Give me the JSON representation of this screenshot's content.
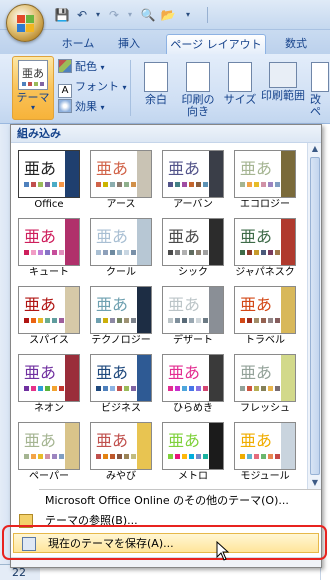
{
  "tabs": [
    {
      "label": "ホーム",
      "active": false
    },
    {
      "label": "挿入",
      "active": false
    },
    {
      "label": "ページ レイアウト",
      "active": true
    },
    {
      "label": "数式",
      "active": false
    }
  ],
  "ribbon": {
    "theme_button": "テーマ",
    "colors": "配色",
    "fonts": "フォント",
    "effects": "効果",
    "margins": "余白",
    "orientation_line1": "印刷の",
    "orientation_line2": "向き",
    "size": "サイズ",
    "print_area": "印刷範囲",
    "breaks_partial": "改ペ"
  },
  "gallery": {
    "header": "組み込み",
    "sample_text": "亜あ",
    "themes": [
      {
        "name": "Office",
        "fold": "#1f3f6f",
        "swatches": [
          "#4f81bd",
          "#c0504d",
          "#9bbb59",
          "#8064a2",
          "#4bacc6",
          "#f79646"
        ]
      },
      {
        "name": "アース",
        "fold": "#c9c3b4",
        "swatches": [
          "#d16349",
          "#ccb400",
          "#8cadae",
          "#8c7b70",
          "#8fb08c",
          "#d19049"
        ]
      },
      {
        "name": "アーバン",
        "fold": "#3a3e48",
        "swatches": [
          "#53548a",
          "#438086",
          "#a04da3",
          "#c4652d",
          "#8b5d3d",
          "#5c92b5"
        ]
      },
      {
        "name": "エコロジー",
        "fold": "#7a6a3a",
        "swatches": [
          "#a5b592",
          "#f3a447",
          "#e7bc29",
          "#d092a7",
          "#9c85c0",
          "#809ec2"
        ]
      },
      {
        "name": "キュート",
        "fold": "#b0306b",
        "swatches": [
          "#ce1e5c",
          "#f19dc5",
          "#c07fd8",
          "#8674c6",
          "#c64d9a",
          "#e18fbd"
        ]
      },
      {
        "name": "クール",
        "fold": "#b7c7d4",
        "swatches": [
          "#a9bfd3",
          "#8ea0ba",
          "#6e8aa0",
          "#9bb6c9",
          "#c8d6e2",
          "#7990a8"
        ]
      },
      {
        "name": "シック",
        "fold": "#2c2c2c",
        "swatches": [
          "#4b4b4b",
          "#7f7f7f",
          "#b0b0b0",
          "#5f6b5f",
          "#8c8071",
          "#a0a0a0"
        ]
      },
      {
        "name": "ジャパネスク",
        "fold": "#b03a2e",
        "swatches": [
          "#3e6b48",
          "#8f3a2c",
          "#c79a2c",
          "#4a5a7a",
          "#7a3b5c",
          "#a07a4a"
        ]
      },
      {
        "name": "スパイス",
        "fold": "#d6c9a8",
        "swatches": [
          "#b01513",
          "#ea6312",
          "#e6b729",
          "#6aac90",
          "#5f9c9d",
          "#9e5e9b"
        ]
      },
      {
        "name": "テクノロジー",
        "fold": "#1d2d44",
        "swatches": [
          "#6ea0b0",
          "#ccaf0a",
          "#8d89a4",
          "#748560",
          "#9e9273",
          "#7e848d"
        ]
      },
      {
        "name": "デザート",
        "fold": "#8a8f96",
        "swatches": [
          "#bcc5c8",
          "#7f8f9b",
          "#5a6b78",
          "#9aa8b2",
          "#cfd6da",
          "#6c7a84"
        ]
      },
      {
        "name": "トラベル",
        "fold": "#d8b85a",
        "swatches": [
          "#d34817",
          "#9b2d1f",
          "#a28e6a",
          "#956251",
          "#918485",
          "#855d5d"
        ]
      },
      {
        "name": "ネオン",
        "fold": "#9a2d3a",
        "swatches": [
          "#7030a0",
          "#e5328a",
          "#2e9cd8",
          "#5bb43c",
          "#f3a32f",
          "#c3352f"
        ]
      },
      {
        "name": "ビジネス",
        "fold": "#2e5a94",
        "swatches": [
          "#1f497d",
          "#4f81bd",
          "#8db3e2",
          "#c0504d",
          "#9bbb59",
          "#8064a2"
        ]
      },
      {
        "name": "ひらめき",
        "fold": "#3a3a3a",
        "swatches": [
          "#e32d91",
          "#c830cc",
          "#4ea6dc",
          "#4775e7",
          "#8971e1",
          "#d54773"
        ]
      },
      {
        "name": "フレッシュ",
        "fold": "#d2d98a",
        "swatches": [
          "#93a299",
          "#cf543f",
          "#b5ae53",
          "#848058",
          "#e8b54d",
          "#786c71"
        ]
      },
      {
        "name": "ペーパー",
        "fold": "#d9c48a",
        "swatches": [
          "#a5b592",
          "#f3a447",
          "#e7bc29",
          "#d092a7",
          "#9c85c0",
          "#809ec2"
        ]
      },
      {
        "name": "みやび",
        "fold": "#e8c451",
        "swatches": [
          "#c0504d",
          "#e48312",
          "#bd582c",
          "#865640",
          "#9b8357",
          "#c2bc80"
        ]
      },
      {
        "name": "メトロ",
        "fold": "#1b1b1b",
        "swatches": [
          "#7fd13b",
          "#ea157a",
          "#feb80a",
          "#00addc",
          "#738ac8",
          "#1ab39f"
        ]
      },
      {
        "name": "モジュール",
        "fold": "#c9d4de",
        "swatches": [
          "#f0ad00",
          "#60b5cc",
          "#e66c7d",
          "#6bb76d",
          "#e88651",
          "#c64847"
        ]
      }
    ]
  },
  "menu": {
    "online": "Microsoft Office Online のその他のテーマ(O)...",
    "browse": "テーマの参照(B)...",
    "save": "現在のテーマを保存(A)..."
  },
  "sheet": {
    "row_number": "22"
  },
  "colors": {
    "highlight_ring": "#e8231f",
    "accent_blue": "#15428b"
  }
}
